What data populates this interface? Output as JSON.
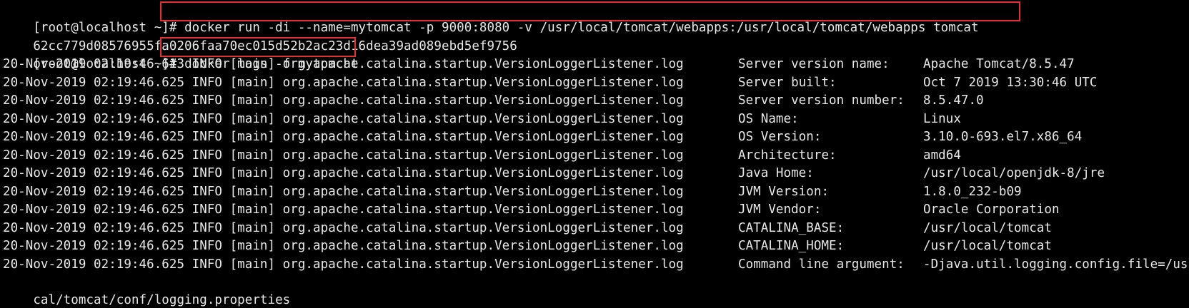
{
  "terminal": {
    "lines": [
      {
        "prompt": "[root@localhost ~]# ",
        "command": "docker run -di --name=mytomcat -p 9000:8080 -v /usr/local/tomcat/webapps:/usr/local/tomcat/webapps tomcat"
      },
      {
        "output": "62cc779d08576955fa0206faa70ec015d52b2ac23d16dea39ad089ebd5ef9756"
      },
      {
        "prompt": "[root@localhost ~]# ",
        "command": "docker logs -f mytomcat"
      }
    ],
    "logs": [
      {
        "prefix": "20-Nov-2019 02:19:46.613 INFO [main] org.apache.catalina.startup.VersionLoggerListener.log",
        "key": "Server version name:",
        "value": "Apache Tomcat/8.5.47"
      },
      {
        "prefix": "20-Nov-2019 02:19:46.625 INFO [main] org.apache.catalina.startup.VersionLoggerListener.log",
        "key": "Server built:",
        "value": "Oct 7 2019 13:30:46 UTC"
      },
      {
        "prefix": "20-Nov-2019 02:19:46.625 INFO [main] org.apache.catalina.startup.VersionLoggerListener.log",
        "key": "Server version number:",
        "value": "8.5.47.0"
      },
      {
        "prefix": "20-Nov-2019 02:19:46.625 INFO [main] org.apache.catalina.startup.VersionLoggerListener.log",
        "key": "OS Name:",
        "value": "Linux"
      },
      {
        "prefix": "20-Nov-2019 02:19:46.625 INFO [main] org.apache.catalina.startup.VersionLoggerListener.log",
        "key": "OS Version:",
        "value": "3.10.0-693.el7.x86_64"
      },
      {
        "prefix": "20-Nov-2019 02:19:46.625 INFO [main] org.apache.catalina.startup.VersionLoggerListener.log",
        "key": "Architecture:",
        "value": "amd64"
      },
      {
        "prefix": "20-Nov-2019 02:19:46.625 INFO [main] org.apache.catalina.startup.VersionLoggerListener.log",
        "key": "Java Home:",
        "value": "/usr/local/openjdk-8/jre"
      },
      {
        "prefix": "20-Nov-2019 02:19:46.625 INFO [main] org.apache.catalina.startup.VersionLoggerListener.log",
        "key": "JVM Version:",
        "value": "1.8.0_232-b09"
      },
      {
        "prefix": "20-Nov-2019 02:19:46.625 INFO [main] org.apache.catalina.startup.VersionLoggerListener.log",
        "key": "JVM Vendor:",
        "value": "Oracle Corporation"
      },
      {
        "prefix": "20-Nov-2019 02:19:46.625 INFO [main] org.apache.catalina.startup.VersionLoggerListener.log",
        "key": "CATALINA_BASE:",
        "value": "/usr/local/tomcat"
      },
      {
        "prefix": "20-Nov-2019 02:19:46.625 INFO [main] org.apache.catalina.startup.VersionLoggerListener.log",
        "key": "CATALINA_HOME:",
        "value": "/usr/local/tomcat"
      },
      {
        "prefix": "20-Nov-2019 02:19:46.625 INFO [main] org.apache.catalina.startup.VersionLoggerListener.log",
        "key": "Command line argument:",
        "value": "-Djava.util.logging.config.file=/usr/lo"
      }
    ],
    "wrapped_tail": "cal/tomcat/conf/logging.properties"
  },
  "colors": {
    "background": "#000000",
    "text": "#e8e8e8",
    "highlight_box": "#e03030"
  }
}
